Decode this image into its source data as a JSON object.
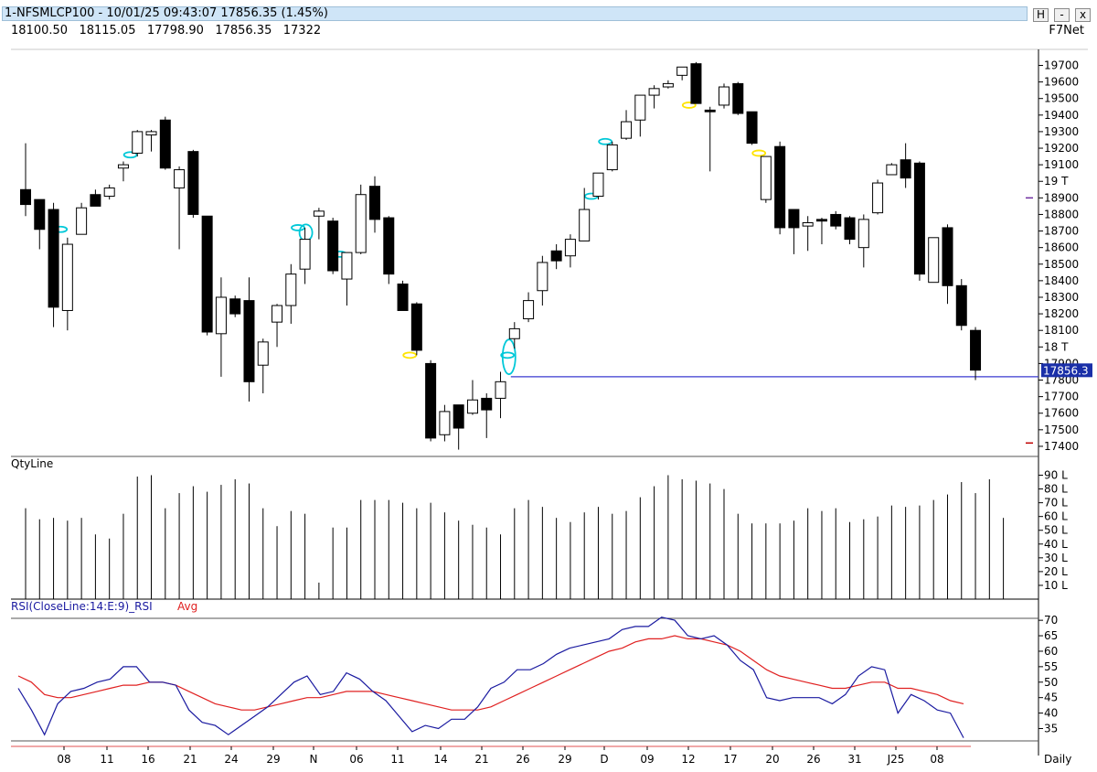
{
  "window": {
    "title": "1-NFSMLCP100 - 10/01/25 09:43:07 17856.35 (1.45%)",
    "buttons": [
      "H",
      "-",
      "x"
    ]
  },
  "info_line": [
    "18100.50",
    "18115.05",
    "17798.90",
    "17856.35",
    "17322"
  ],
  "source": "F7Net",
  "chart_data": [
    {
      "type": "candlestick",
      "title": "1-NFSMLCP100",
      "period": "Daily",
      "ylim": [
        17350,
        19780
      ],
      "y_ticks": [
        "19700",
        "19600",
        "19500",
        "19400",
        "19300",
        "19200",
        "19100",
        "19 T",
        "18900",
        "18800",
        "18700",
        "18600",
        "18500",
        "18400",
        "18300",
        "18200",
        "18100",
        "18 T",
        "17900",
        "17800",
        "17700",
        "17600",
        "17500",
        "17400"
      ],
      "last_price": 17856.35,
      "last_price_label": "17856.3",
      "horizontal_line": 17820,
      "x_labels": [
        "08",
        "11",
        "16",
        "21",
        "24",
        "29",
        "N",
        "06",
        "11",
        "14",
        "21",
        "26",
        "29",
        "D",
        "09",
        "12",
        "17",
        "20",
        "26",
        "31",
        "J25",
        "08",
        "Daily"
      ],
      "candles": [
        {
          "o": 18950,
          "h": 19230,
          "l": 18790,
          "c": 18860
        },
        {
          "o": 18890,
          "h": 18870,
          "l": 18590,
          "c": 18710
        },
        {
          "o": 18830,
          "h": 18870,
          "l": 18120,
          "c": 18240
        },
        {
          "o": 18220,
          "h": 18660,
          "l": 18100,
          "c": 18620
        },
        {
          "o": 18680,
          "h": 18870,
          "l": 18680,
          "c": 18840
        },
        {
          "o": 18920,
          "h": 18950,
          "l": 18860,
          "c": 18850
        },
        {
          "o": 18910,
          "h": 18980,
          "l": 18890,
          "c": 18960
        },
        {
          "o": 19080,
          "h": 19120,
          "l": 19000,
          "c": 19100
        },
        {
          "o": 19170,
          "h": 19310,
          "l": 19150,
          "c": 19300
        },
        {
          "o": 19280,
          "h": 19310,
          "l": 19180,
          "c": 19300
        },
        {
          "o": 19370,
          "h": 19390,
          "l": 19070,
          "c": 19080
        },
        {
          "o": 18960,
          "h": 19090,
          "l": 18590,
          "c": 19070
        },
        {
          "o": 19180,
          "h": 19190,
          "l": 18780,
          "c": 18800
        },
        {
          "o": 18790,
          "h": 18790,
          "l": 18070,
          "c": 18090
        },
        {
          "o": 18080,
          "h": 18420,
          "l": 17820,
          "c": 18300
        },
        {
          "o": 18290,
          "h": 18310,
          "l": 18180,
          "c": 18200
        },
        {
          "o": 18280,
          "h": 18420,
          "l": 17670,
          "c": 17790
        },
        {
          "o": 17890,
          "h": 18050,
          "l": 17720,
          "c": 18030
        },
        {
          "o": 18150,
          "h": 18260,
          "l": 18000,
          "c": 18250
        },
        {
          "o": 18250,
          "h": 18500,
          "l": 18140,
          "c": 18440
        },
        {
          "o": 18470,
          "h": 18720,
          "l": 18380,
          "c": 18650
        },
        {
          "o": 18790,
          "h": 18840,
          "l": 18650,
          "c": 18820
        },
        {
          "o": 18760,
          "h": 18780,
          "l": 18440,
          "c": 18460
        },
        {
          "o": 18410,
          "h": 18520,
          "l": 18250,
          "c": 18570
        },
        {
          "o": 18570,
          "h": 18980,
          "l": 18560,
          "c": 18920
        },
        {
          "o": 18970,
          "h": 19030,
          "l": 18690,
          "c": 18770
        },
        {
          "o": 18780,
          "h": 18790,
          "l": 18380,
          "c": 18440
        },
        {
          "o": 18380,
          "h": 18400,
          "l": 18220,
          "c": 18220
        },
        {
          "o": 18260,
          "h": 18270,
          "l": 17950,
          "c": 17980
        },
        {
          "o": 17900,
          "h": 17920,
          "l": 17430,
          "c": 17450
        },
        {
          "o": 17470,
          "h": 17650,
          "l": 17430,
          "c": 17610
        },
        {
          "o": 17650,
          "h": 17620,
          "l": 17380,
          "c": 17510
        },
        {
          "o": 17600,
          "h": 17800,
          "l": 17590,
          "c": 17680
        },
        {
          "o": 17690,
          "h": 17720,
          "l": 17450,
          "c": 17620
        },
        {
          "o": 17690,
          "h": 17850,
          "l": 17570,
          "c": 17790
        },
        {
          "o": 18050,
          "h": 18150,
          "l": 17990,
          "c": 18110
        },
        {
          "o": 18170,
          "h": 18330,
          "l": 18150,
          "c": 18280
        },
        {
          "o": 18340,
          "h": 18550,
          "l": 18250,
          "c": 18510
        },
        {
          "o": 18580,
          "h": 18620,
          "l": 18470,
          "c": 18520
        },
        {
          "o": 18550,
          "h": 18680,
          "l": 18480,
          "c": 18650
        },
        {
          "o": 18640,
          "h": 18960,
          "l": 18640,
          "c": 18830
        },
        {
          "o": 18910,
          "h": 19050,
          "l": 18890,
          "c": 19050
        },
        {
          "o": 19070,
          "h": 19240,
          "l": 19060,
          "c": 19220
        },
        {
          "o": 19260,
          "h": 19430,
          "l": 19250,
          "c": 19360
        },
        {
          "o": 19370,
          "h": 19490,
          "l": 19270,
          "c": 19520
        },
        {
          "o": 19520,
          "h": 19580,
          "l": 19440,
          "c": 19560
        },
        {
          "o": 19570,
          "h": 19610,
          "l": 19560,
          "c": 19590
        },
        {
          "o": 19640,
          "h": 19690,
          "l": 19610,
          "c": 19690
        },
        {
          "o": 19710,
          "h": 19720,
          "l": 19620,
          "c": 19470
        },
        {
          "o": 19430,
          "h": 19450,
          "l": 19060,
          "c": 19420
        },
        {
          "o": 19460,
          "h": 19590,
          "l": 19440,
          "c": 19570
        },
        {
          "o": 19590,
          "h": 19600,
          "l": 19400,
          "c": 19410
        },
        {
          "o": 19420,
          "h": 19420,
          "l": 19220,
          "c": 19230
        },
        {
          "o": 18890,
          "h": 19150,
          "l": 18870,
          "c": 19150
        },
        {
          "o": 19210,
          "h": 19240,
          "l": 18680,
          "c": 18720
        },
        {
          "o": 18830,
          "h": 18830,
          "l": 18560,
          "c": 18720
        },
        {
          "o": 18730,
          "h": 18790,
          "l": 18580,
          "c": 18750
        },
        {
          "o": 18770,
          "h": 18780,
          "l": 18620,
          "c": 18760
        },
        {
          "o": 18800,
          "h": 18820,
          "l": 18710,
          "c": 18730
        },
        {
          "o": 18780,
          "h": 18790,
          "l": 18620,
          "c": 18650
        },
        {
          "o": 18600,
          "h": 18800,
          "l": 18480,
          "c": 18770
        },
        {
          "o": 18810,
          "h": 19010,
          "l": 18800,
          "c": 18990
        },
        {
          "o": 19040,
          "h": 19110,
          "l": 19040,
          "c": 19100
        },
        {
          "o": 19130,
          "h": 19230,
          "l": 18960,
          "c": 19020
        },
        {
          "o": 19110,
          "h": 19120,
          "l": 18400,
          "c": 18440
        },
        {
          "o": 18390,
          "h": 18660,
          "l": 18390,
          "c": 18660
        },
        {
          "o": 18720,
          "h": 18740,
          "l": 18260,
          "c": 18370
        },
        {
          "o": 18370,
          "h": 18410,
          "l": 18100,
          "c": 18130
        },
        {
          "o": 18100,
          "h": 18120,
          "l": 17800,
          "c": 17860
        }
      ],
      "gaps": [
        {
          "i": 3,
          "v": 18710,
          "color": "#00c8d8"
        },
        {
          "i": 8,
          "v": 19160,
          "color": "#00c8d8"
        },
        {
          "i": 20,
          "v": 18720,
          "color": "#00c8d8"
        },
        {
          "i": 23,
          "v": 18560,
          "color": "#00c8d8"
        },
        {
          "i": 28,
          "v": 17950,
          "color": "#ffe400"
        },
        {
          "i": 35,
          "v": 17950,
          "color": "#00c8d8"
        },
        {
          "i": 41,
          "v": 18910,
          "color": "#00c8d8"
        },
        {
          "i": 42,
          "v": 19240,
          "color": "#00c8d8"
        },
        {
          "i": 48,
          "v": 19460,
          "color": "#ffe400"
        },
        {
          "i": 53,
          "v": 19170,
          "color": "#ffe400"
        }
      ]
    },
    {
      "type": "bar",
      "title": "QtyLine",
      "ylim": [
        0,
        95
      ],
      "y_ticks": [
        "90 L",
        "80 L",
        "70 L",
        "60 L",
        "50 L",
        "40 L",
        "30 L",
        "20 L",
        "10 L"
      ],
      "values": [
        66,
        58,
        59,
        57,
        59,
        47,
        44,
        62,
        89,
        90,
        66,
        77,
        82,
        78,
        83,
        87,
        84,
        66,
        53,
        64,
        62,
        12,
        52,
        52,
        72,
        72,
        72,
        70,
        66,
        70,
        63,
        57,
        54,
        52,
        47,
        66,
        72,
        67,
        59,
        56,
        63,
        67,
        62,
        64,
        74,
        82,
        90,
        87,
        86,
        84,
        80,
        62,
        55,
        55,
        55,
        57,
        66,
        64,
        66,
        56,
        58,
        60,
        68,
        67,
        68,
        72,
        76,
        85,
        77,
        87,
        59
      ]
    },
    {
      "type": "line",
      "title": "RSI(CloseLine:14:E:9)_RSI",
      "legend": [
        "RSI(CloseLine:14:E:9)_RSI",
        "Avg"
      ],
      "ylim": [
        31,
        73
      ],
      "y_ticks": [
        "70",
        "65",
        "60",
        "55",
        "50",
        "45",
        "40",
        "35"
      ],
      "series": [
        {
          "name": "RSI(CloseLine:14:E:9)_RSI",
          "color": "#1a1aa0",
          "values": [
            48,
            41,
            33,
            43,
            47,
            48,
            50,
            51,
            55,
            55,
            50,
            50,
            49,
            41,
            37,
            36,
            33,
            36,
            39,
            42,
            46,
            50,
            52,
            46,
            47,
            53,
            51,
            47,
            44,
            39,
            34,
            36,
            35,
            38,
            38,
            42,
            48,
            50,
            54,
            54,
            56,
            59,
            61,
            62,
            63,
            64,
            67,
            68,
            68,
            71,
            70,
            65,
            64,
            65,
            62,
            57,
            54,
            45,
            44,
            45,
            45,
            45,
            43,
            46,
            52,
            55,
            54,
            40,
            46,
            44,
            41,
            40,
            32
          ]
        },
        {
          "name": "Avg",
          "color": "#e02020",
          "values": [
            52,
            50,
            46,
            45,
            45,
            46,
            47,
            48,
            49,
            49,
            50,
            50,
            49,
            47,
            45,
            43,
            42,
            41,
            41,
            42,
            43,
            44,
            45,
            45,
            46,
            47,
            47,
            47,
            46,
            45,
            44,
            43,
            42,
            41,
            41,
            41,
            42,
            44,
            46,
            48,
            50,
            52,
            54,
            56,
            58,
            60,
            61,
            63,
            64,
            64,
            65,
            64,
            64,
            63,
            62,
            60,
            57,
            54,
            52,
            51,
            50,
            49,
            48,
            48,
            49,
            50,
            50,
            48,
            48,
            47,
            46,
            44,
            43
          ]
        }
      ]
    }
  ]
}
